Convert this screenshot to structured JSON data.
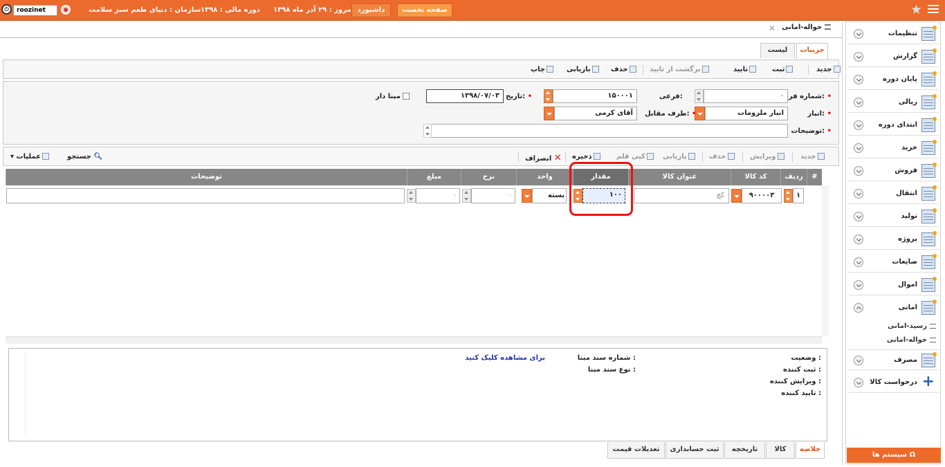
{
  "topbar": {
    "user": "roozinet",
    "home_label": "صفحه نخست",
    "dashboard_label": "داشبورد",
    "today_label": "امروز :",
    "today_value": "۲۹ آذر ماه ۱۳۹۸",
    "period_label": "دوره مالی :",
    "period_value": "۱۳۹۸",
    "org_label": "سازمان :",
    "org_value": "دنیای طعم سبز سلامت"
  },
  "doc_tab": {
    "title": "حواله-امانی"
  },
  "view_tabs": [
    {
      "label": "جزییات",
      "active": true
    },
    {
      "label": "لیست",
      "active": false
    }
  ],
  "toolbar": {
    "new": "جدید",
    "register": "ثبت",
    "confirm": "تایید",
    "unconfirm": "برگشت از تایید",
    "delete": "حذف",
    "refresh": "بازیابی",
    "print": "چاپ"
  },
  "form": {
    "form_no_label": "شماره فرم:",
    "form_no_value": "۰",
    "sub_label": "فرعی:",
    "sub_value": "۱۵۰۰۰۱",
    "date_label": "تاریخ:",
    "date_value": "۱۳۹۸/۰۷/۰۳",
    "has_base_label": "مبنا دار",
    "warehouse_label": "انبار:",
    "warehouse_value": "انبار ملزومات",
    "counterparty_label": "طرف مقابل:",
    "counterparty_value": "آقای  کرمی",
    "notes_label": "توضیحات:"
  },
  "grid_toolbar": {
    "new": "جدید",
    "edit": "ویرایش",
    "delete": "حذف",
    "refresh": "بازیابی",
    "copy": "کپی قلم",
    "save": "ذخیره",
    "cancel": "انصراف",
    "search": "جستجو",
    "actions": "عملیات"
  },
  "grid": {
    "columns": {
      "hash": "#",
      "row": "ردیف",
      "code": "کد کالا",
      "title": "عنوان کالا",
      "qty": "مقدار",
      "unit": "واحد",
      "rate": "نرخ",
      "amount": "مبلغ",
      "notes": "توضیحات"
    },
    "rows": [
      {
        "row": "۱",
        "code": "۹۰۰۰۰۳",
        "title": "کچ",
        "qty": "۱۰۰",
        "unit": "بسته",
        "rate": "۰",
        "amount": "۰"
      }
    ]
  },
  "summary": {
    "status_label": "وضعیت :",
    "creator_label": "ثبت کننده :",
    "editor_label": "ویرایش کننده :",
    "approver_label": "تایید کننده :",
    "base_no_label": "شماره سند مبنا :",
    "base_type_label": "نوع سند مبنا :",
    "view_link": "برای مشاهده کلیک کنید"
  },
  "bottom_tabs": [
    {
      "label": "خلاصه",
      "active": true
    },
    {
      "label": "کالا"
    },
    {
      "label": "تاریخچه"
    },
    {
      "label": "ثبت حسابداری"
    },
    {
      "label": "تعدیلات قیمت"
    }
  ],
  "sidebar": {
    "items": [
      {
        "label": "تنظیمات",
        "icon": "settings-folder-icon"
      },
      {
        "label": "گزارش",
        "icon": "report-icon"
      },
      {
        "label": "پایان دوره",
        "icon": "folders-icon"
      },
      {
        "label": "ریالی",
        "icon": "money-icon"
      },
      {
        "label": "ابتدای دوره",
        "icon": "grid-icon"
      },
      {
        "label": "خرید",
        "icon": "grid-icon"
      },
      {
        "label": "فروش",
        "icon": "grid-icon"
      },
      {
        "label": "انتقال",
        "icon": "grid-icon"
      },
      {
        "label": "تولید",
        "icon": "grid-icon"
      },
      {
        "label": "پروژه",
        "icon": "grid-icon"
      },
      {
        "label": "ضایعات",
        "icon": "grid-icon"
      },
      {
        "label": "اموال",
        "icon": "grid-icon"
      },
      {
        "label": "امانی",
        "icon": "grid-icon"
      },
      {
        "label": "مصرف",
        "icon": "grid-icon"
      },
      {
        "label": "درخواست کالا",
        "icon": "plus-icon"
      }
    ],
    "sub_items": [
      "رسید-امانی",
      "حواله-امانی"
    ],
    "system_label": "سیستم ها"
  },
  "colors": {
    "accent": "#ec6a2c",
    "highlight": "#e11111",
    "link": "#2233aa"
  }
}
